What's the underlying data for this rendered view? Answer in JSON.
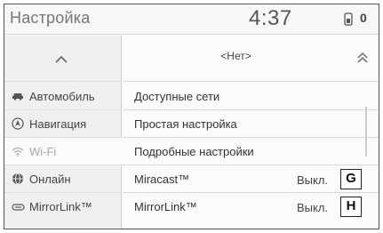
{
  "header": {
    "title": "Настройка",
    "clock": "4:37",
    "phone_count": "0"
  },
  "sidebar": {
    "items": [
      {
        "label": "Автомобиль",
        "icon": "car-icon",
        "active": false
      },
      {
        "label": "Навигация",
        "icon": "navigation-icon",
        "active": false
      },
      {
        "label": "Wi-Fi",
        "icon": "wifi-icon",
        "active": true
      },
      {
        "label": "Онлайн",
        "icon": "globe-icon",
        "active": false
      },
      {
        "label": "MirrorLink™",
        "icon": "mirrorlink-icon",
        "active": false
      }
    ]
  },
  "main": {
    "network_label": "<Нет>",
    "rows": [
      {
        "label": "Доступные сети",
        "value": "",
        "badge": ""
      },
      {
        "label": "Простая настройка",
        "value": "",
        "badge": ""
      },
      {
        "label": "Подробные настройки",
        "value": "",
        "badge": ""
      },
      {
        "label": "Miracast™",
        "value": "Выкл.",
        "badge": "G"
      },
      {
        "label": "MirrorLink™",
        "value": "Выкл.",
        "badge": "H"
      }
    ]
  },
  "colors": {
    "background": "#fbfbfb",
    "sidebar": "#f0f0f0",
    "active_text": "#aaaaaa"
  }
}
